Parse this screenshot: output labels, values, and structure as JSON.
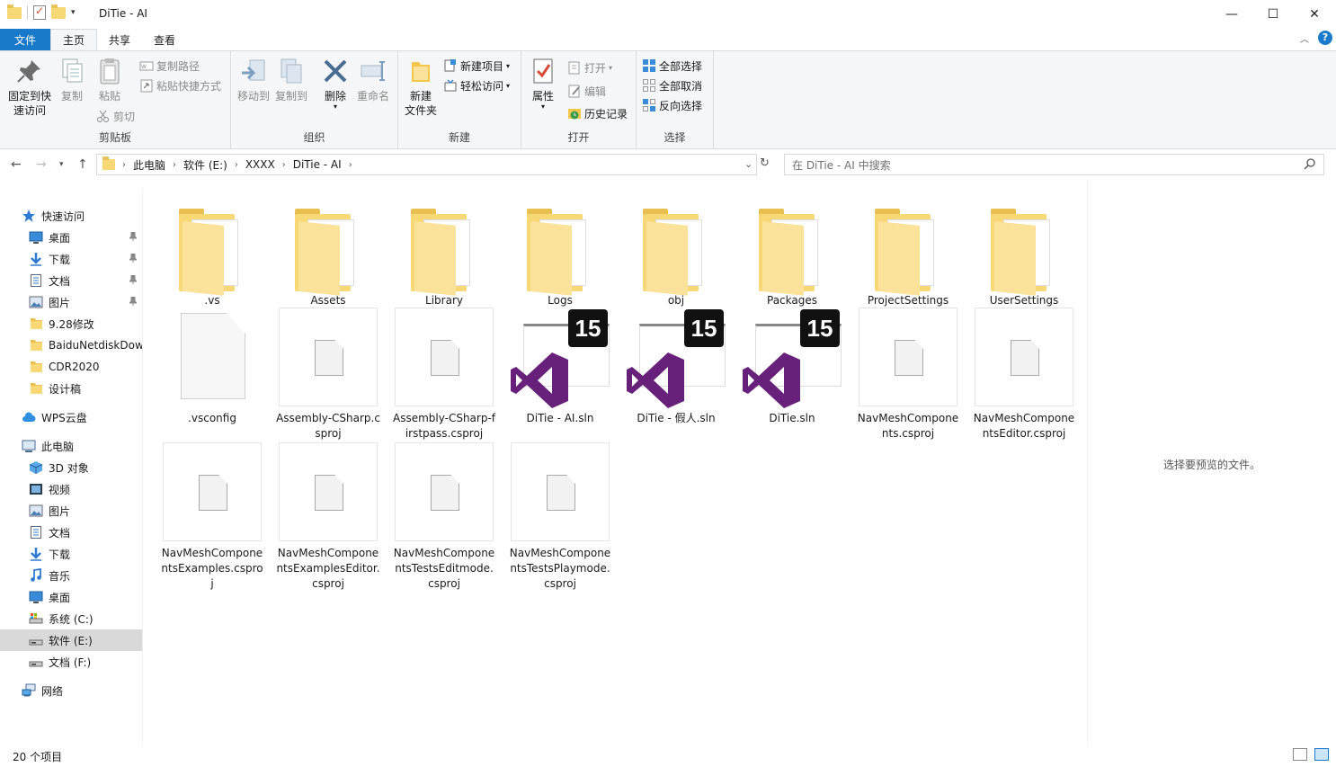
{
  "window": {
    "title": "DiTie - AI",
    "controls": {
      "minimize": "—",
      "maximize": "☐",
      "close": "✕"
    }
  },
  "ribbon_tabs": [
    "文件",
    "主页",
    "共享",
    "查看"
  ],
  "ribbon": {
    "clipboard": {
      "label": "剪贴板",
      "pin": "固定到快\n速访问",
      "copy": "复制",
      "paste": "粘贴",
      "copy_path": "复制路径",
      "paste_shortcut": "粘贴快捷方式",
      "cut": "剪切"
    },
    "organize": {
      "label": "组织",
      "move_to": "移动到",
      "copy_to": "复制到",
      "delete": "删除",
      "rename": "重命名"
    },
    "new": {
      "label": "新建",
      "new_folder": "新建\n文件夹",
      "new_item": "新建项目",
      "easy_access": "轻松访问"
    },
    "open": {
      "label": "打开",
      "properties": "属性",
      "open": "打开",
      "edit": "编辑",
      "history": "历史记录"
    },
    "select": {
      "label": "选择",
      "select_all": "全部选择",
      "select_none": "全部取消",
      "invert": "反向选择"
    }
  },
  "address": {
    "crumbs": [
      "此电脑",
      "软件 (E:)",
      "XXXX",
      "DiTie - AI"
    ],
    "search_placeholder": "在 DiTie - AI 中搜索"
  },
  "sidebar": [
    {
      "label": "快速访问",
      "icon": "star-icon"
    },
    {
      "label": "桌面",
      "icon": "desktop-icon",
      "pinned": true
    },
    {
      "label": "下载",
      "icon": "download-icon",
      "pinned": true
    },
    {
      "label": "文档",
      "icon": "document-icon",
      "pinned": true
    },
    {
      "label": "图片",
      "icon": "picture-icon",
      "pinned": true
    },
    {
      "label": "9.28修改",
      "icon": "folder-icon"
    },
    {
      "label": "BaiduNetdiskDow",
      "icon": "folder-icon"
    },
    {
      "label": "CDR2020",
      "icon": "folder-icon"
    },
    {
      "label": "设计稿",
      "icon": "folder-icon"
    },
    {
      "label": "WPS云盘",
      "icon": "cloud-icon"
    },
    {
      "label": "此电脑",
      "icon": "computer-icon"
    },
    {
      "label": "3D 对象",
      "icon": "cube-icon"
    },
    {
      "label": "视频",
      "icon": "video-icon"
    },
    {
      "label": "图片",
      "icon": "picture-icon"
    },
    {
      "label": "文档",
      "icon": "document-icon"
    },
    {
      "label": "下载",
      "icon": "download-icon"
    },
    {
      "label": "音乐",
      "icon": "music-icon"
    },
    {
      "label": "桌面",
      "icon": "desktop-icon"
    },
    {
      "label": "系统 (C:)",
      "icon": "drive-c-icon"
    },
    {
      "label": "软件 (E:)",
      "icon": "drive-icon",
      "selected": true
    },
    {
      "label": "文档 (F:)",
      "icon": "drive-icon"
    },
    {
      "label": "网络",
      "icon": "network-icon"
    }
  ],
  "files": [
    {
      "name": ".vs",
      "type": "folder"
    },
    {
      "name": "Assets",
      "type": "folder"
    },
    {
      "name": "Library",
      "type": "folder"
    },
    {
      "name": "Logs",
      "type": "folder"
    },
    {
      "name": "obj",
      "type": "folder"
    },
    {
      "name": "Packages",
      "type": "folder"
    },
    {
      "name": "ProjectSettings",
      "type": "folder"
    },
    {
      "name": "UserSettings",
      "type": "folder"
    },
    {
      "name": ".vsconfig",
      "type": "file"
    },
    {
      "name": "Assembly-CSharp.csproj",
      "type": "csproj"
    },
    {
      "name": "Assembly-CSharp-firstpass.csproj",
      "type": "csproj"
    },
    {
      "name": "DiTie - AI.sln",
      "type": "sln",
      "badge": "15"
    },
    {
      "name": "DiTie - 假人.sln",
      "type": "sln",
      "badge": "15"
    },
    {
      "name": "DiTie.sln",
      "type": "sln",
      "badge": "15"
    },
    {
      "name": "NavMeshComponents.csproj",
      "type": "csproj"
    },
    {
      "name": "NavMeshComponentsEditor.csproj",
      "type": "csproj"
    },
    {
      "name": "NavMeshComponentsExamples.csproj",
      "type": "csproj"
    },
    {
      "name": "NavMeshComponentsExamplesEditor.csproj",
      "type": "csproj"
    },
    {
      "name": "NavMeshComponentsTestsEditmode.csproj",
      "type": "csproj"
    },
    {
      "name": "NavMeshComponentsTestsPlaymode.csproj",
      "type": "csproj"
    }
  ],
  "preview_message": "选择要预览的文件。",
  "status": {
    "count": "20 个项目"
  },
  "colors": {
    "accent": "#1979ca",
    "folder": "#f8d775",
    "vs_purple": "#68217a"
  }
}
